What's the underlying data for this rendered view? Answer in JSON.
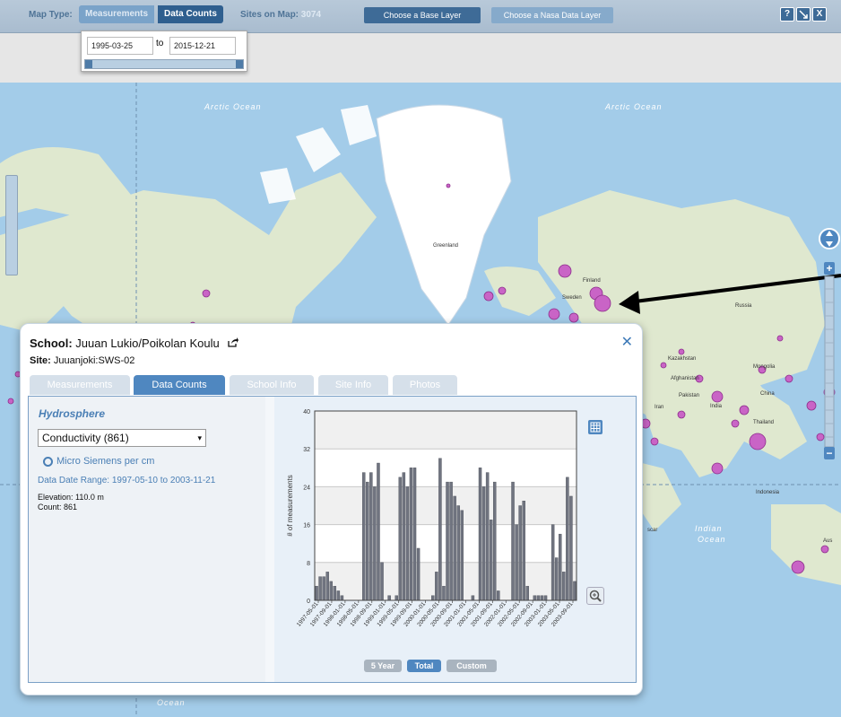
{
  "topbar": {
    "map_type_label": "Map Type:",
    "measurements_label": "Measurements",
    "data_counts_label": "Data Counts",
    "sites_label": "Sites on Map:",
    "sites_count": "3074",
    "base_layer_label": "Choose a Base Layer",
    "nasa_layer_label": "Choose a Nasa Data Layer",
    "help_icon": "?",
    "close_icon": "X"
  },
  "dates": {
    "from": "1995-03-25",
    "to_label": "to",
    "to": "2015-12-21"
  },
  "map": {
    "labels": [
      {
        "text": "Arctic Ocean",
        "name": "arctic-ocean-label-1"
      },
      {
        "text": "Arctic Ocean",
        "name": "arctic-ocean-label-2"
      },
      {
        "text": "Greenland",
        "name": "greenland-label"
      },
      {
        "text": "Finland",
        "name": "finland-label"
      },
      {
        "text": "Sweden",
        "name": "sweden-label"
      },
      {
        "text": "Russia",
        "name": "russia-label"
      },
      {
        "text": "Kazakhstan",
        "name": "kazakhstan-label"
      },
      {
        "text": "Mongolia",
        "name": "mongolia-label"
      },
      {
        "text": "China",
        "name": "china-label"
      },
      {
        "text": "Afghanistan",
        "name": "afghanistan-label"
      },
      {
        "text": "Iran",
        "name": "iran-label"
      },
      {
        "text": "Pakistan",
        "name": "pakistan-label"
      },
      {
        "text": "India",
        "name": "india-label"
      },
      {
        "text": "Thailand",
        "name": "thailand-label"
      },
      {
        "text": "Indonesia",
        "name": "indonesia-label"
      },
      {
        "text": "Indian",
        "name": "indian-label"
      },
      {
        "text": "Ocean",
        "name": "indian-ocean-label"
      },
      {
        "text": "Ocean",
        "name": "ocean-label-bottom"
      },
      {
        "text": "Aus",
        "name": "australia-label"
      },
      {
        "text": "scar",
        "name": "madagascar-label"
      }
    ]
  },
  "popup": {
    "school_prefix": "School:",
    "school_name": "Juuan Lukio/Poikolan Koulu",
    "site_prefix": "Site:",
    "site_name": "Juuanjoki:SWS-02",
    "tabs": [
      "Measurements",
      "Data Counts",
      "School Info",
      "Site Info",
      "Photos"
    ],
    "active_tab": "Data Counts",
    "category": "Hydrosphere",
    "parameter": "Conductivity (861)",
    "unit": "Micro Siemens per cm",
    "range_label": "Data Date Range:",
    "range_value": "1997-05-10 to 2003-11-21",
    "elevation": "Elevation: 110.0 m",
    "count": "Count: 861",
    "buttons": [
      "5 Year",
      "Total",
      "Custom"
    ],
    "active_button": "Total"
  },
  "chart_data": {
    "type": "bar",
    "title": "",
    "xlabel": "",
    "ylabel": "# of measurements",
    "ylim": [
      0,
      40
    ],
    "yticks": [
      0,
      8,
      16,
      24,
      32,
      40
    ],
    "grid": true,
    "bar_color": "#707480",
    "tick_labels": [
      "1997-05-01",
      "1997-09-01",
      "1998-01-01",
      "1998-05-01",
      "1998-09-01",
      "1999-01-01",
      "1999-05-01",
      "1999-09-01",
      "2000-01-01",
      "2000-05-01",
      "2000-09-01",
      "2001-01-01",
      "2001-05-01",
      "2001-09-01",
      "2002-01-01",
      "2002-05-01",
      "2002-09-01",
      "2003-01-01",
      "2003-05-01",
      "2003-09-01"
    ],
    "values": [
      3,
      5,
      5,
      6,
      4,
      3,
      2,
      1,
      0,
      0,
      0,
      0,
      0,
      27,
      25,
      27,
      24,
      29,
      8,
      0,
      1,
      0,
      1,
      26,
      27,
      24,
      28,
      28,
      11,
      0,
      0,
      0,
      1,
      6,
      30,
      3,
      25,
      25,
      22,
      20,
      19,
      0,
      0,
      1,
      0,
      28,
      24,
      27,
      17,
      25,
      2,
      0,
      0,
      0,
      25,
      16,
      20,
      21,
      3,
      0,
      1,
      1,
      1,
      1,
      0,
      16,
      9,
      14,
      6,
      26,
      22,
      4
    ]
  }
}
